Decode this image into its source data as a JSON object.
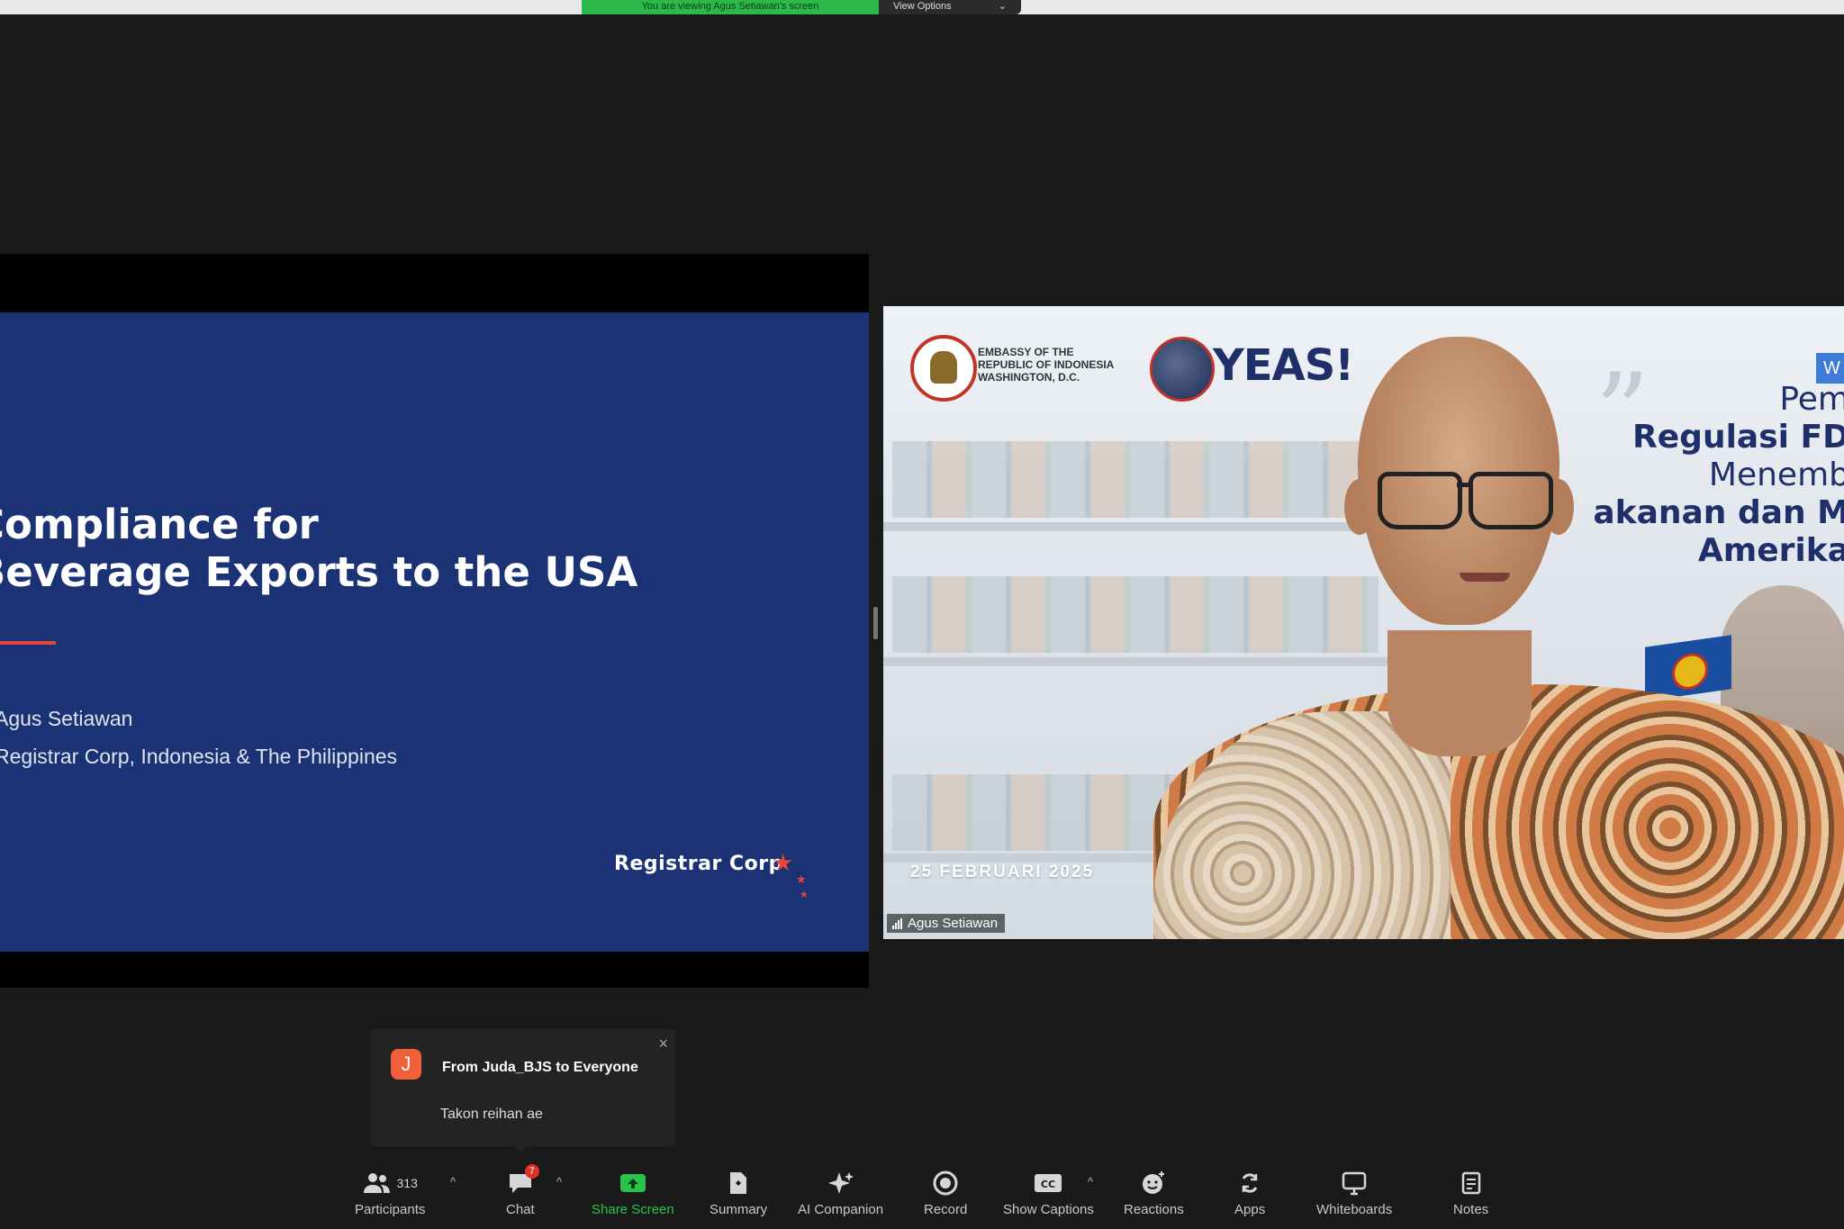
{
  "meeting": {
    "viewing_banner": "You are viewing Agus Setiawan's screen",
    "view_options_label": "View Options",
    "view_options_caret": "⌄"
  },
  "slide": {
    "title_line1": "Compliance for",
    "title_line2": "Beverage Exports to the USA",
    "presenter": "Agus Setiawan",
    "region": "Registrar Corp, Indonesia & The Philippines",
    "logo_text": "Registrar Corp",
    "accent_color": "#e2473d",
    "background_color": "#1b3275"
  },
  "video": {
    "participant_name": "Agus Setiawan",
    "embassy_text": "EMBASSY OF THE\nREPUBLIC OF INDONESIA\nWASHINGTON, D.C.",
    "yeas_logo": "YEAS!",
    "webinar_badge": "W",
    "banner_lines": [
      "Pem",
      "Regulasi FD",
      "Menemb",
      "akanan dan M",
      "Amerika"
    ],
    "date": "25 FEBRUARI 2025"
  },
  "chat_toast": {
    "avatar_letter": "J",
    "from": "From Juda_BJS to Everyone",
    "message": "Takon reihan ae",
    "close": "×"
  },
  "toolbar": {
    "participants": {
      "label": "Participants",
      "count": "313",
      "icon": "participants-icon"
    },
    "chat": {
      "label": "Chat",
      "badge": "7",
      "icon": "chat-icon"
    },
    "share_screen": {
      "label": "Share Screen",
      "icon": "share-screen-icon"
    },
    "summary": {
      "label": "Summary",
      "icon": "summary-icon"
    },
    "ai_companion": {
      "label": "AI Companion",
      "icon": "ai-companion-icon"
    },
    "record": {
      "label": "Record",
      "icon": "record-icon"
    },
    "show_captions": {
      "label": "Show Captions",
      "icon": "captions-icon"
    },
    "reactions": {
      "label": "Reactions",
      "icon": "reactions-icon"
    },
    "apps": {
      "label": "Apps",
      "icon": "apps-icon"
    },
    "whiteboards": {
      "label": "Whiteboards",
      "icon": "whiteboards-icon"
    },
    "notes": {
      "label": "Notes",
      "icon": "notes-icon"
    },
    "caret": "^"
  }
}
